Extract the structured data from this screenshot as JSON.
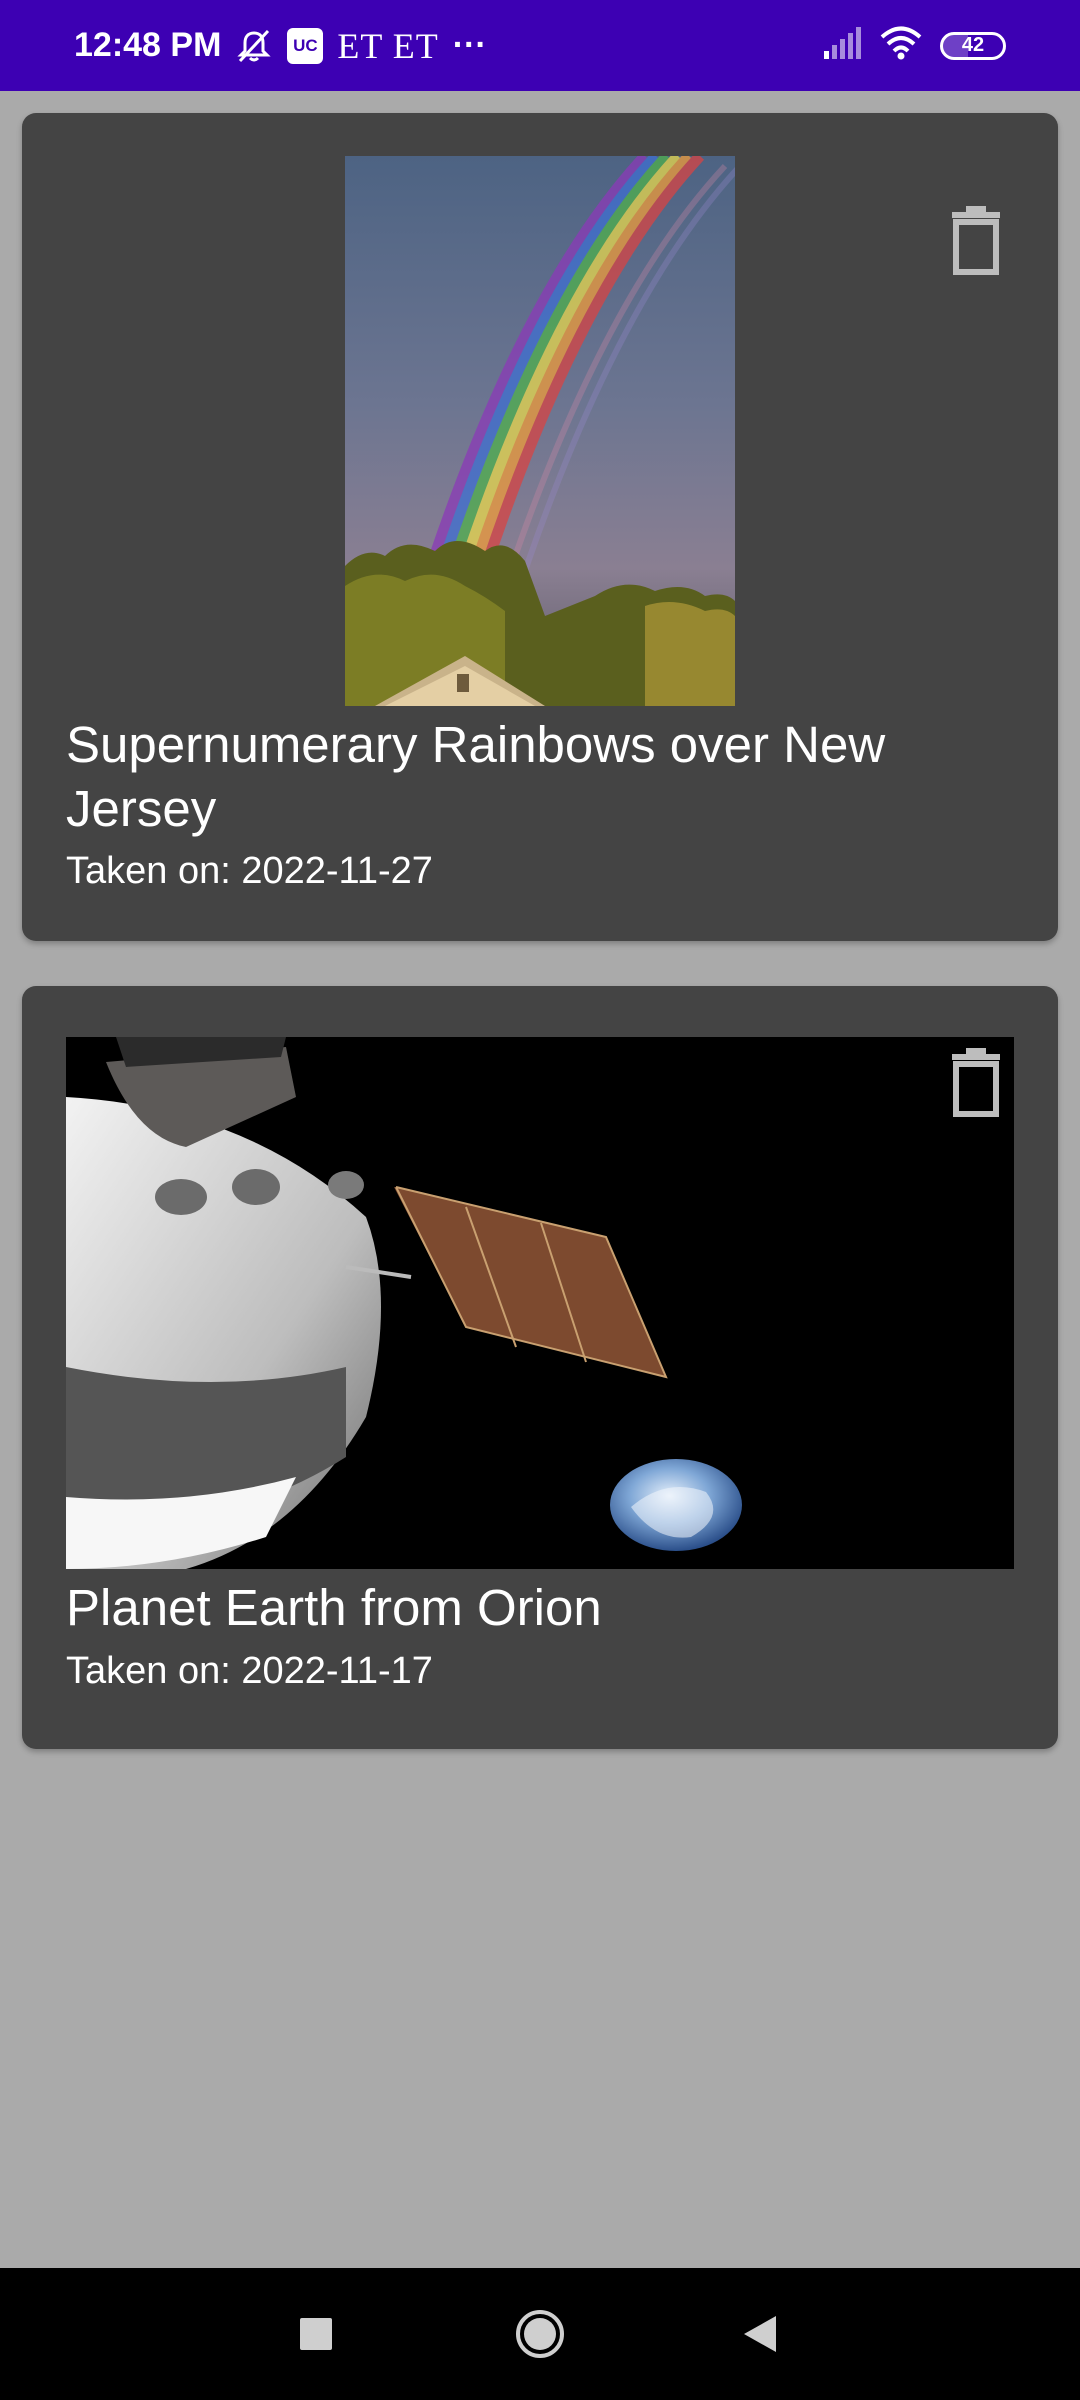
{
  "status_bar": {
    "time": "12:48 PM",
    "uc_label": "UC",
    "carrier": "ET ET",
    "more": "···",
    "battery": "42",
    "icons": [
      "mute-icon",
      "uc-icon",
      "signal-icon",
      "wifi-icon",
      "battery-icon"
    ]
  },
  "cards": [
    {
      "title": "Supernumerary Rainbows over New Jersey",
      "date": "Taken on: 2022-11-27",
      "delete_icon": "trash-icon",
      "image": "rainbow-photo"
    },
    {
      "title": "Planet Earth from Orion",
      "date": "Taken on: 2022-11-17",
      "delete_icon": "trash-icon",
      "image": "orion-earth-photo"
    }
  ],
  "nav_bar": {
    "icons": [
      "recents-square-icon",
      "home-circle-icon",
      "back-triangle-icon"
    ]
  },
  "colors": {
    "status_bar": "#3d00b3",
    "background": "#aaaaaa",
    "card": "#444444",
    "text": "#ffffff",
    "icon": "#bdbdbd"
  }
}
